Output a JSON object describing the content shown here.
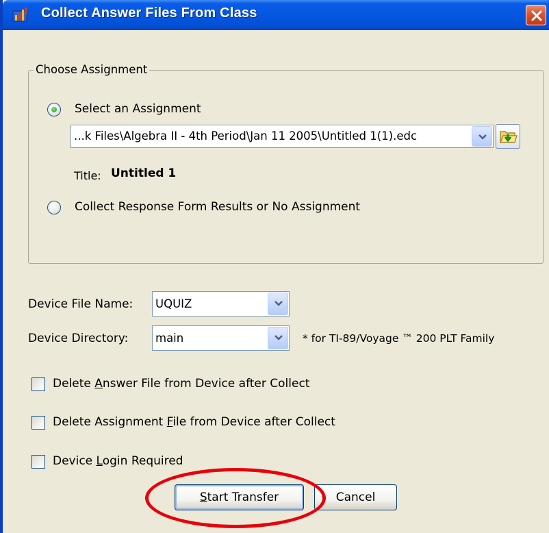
{
  "window": {
    "title": "Collect Answer Files From Class"
  },
  "group": {
    "legend": "Choose Assignment"
  },
  "assignment": {
    "select_label": "Select an Assignment",
    "select_checked": true,
    "path_value": "...k Files\\Algebra II - 4th Period\\Jan 11 2005\\Untitled 1(1).edc",
    "title_label": "Title:",
    "title_value": "Untitled 1",
    "collect_label": "Collect Response Form Results or No Assignment",
    "collect_checked": false
  },
  "device": {
    "file_name_label": "Device File Name:",
    "file_name_value": "UQUIZ",
    "directory_label": "Device Directory:",
    "directory_value": "main",
    "directory_note": "* for TI-89/Voyage ™ 200 PLT Family"
  },
  "options": {
    "delete_answer_pre": "Delete ",
    "delete_answer_key": "A",
    "delete_answer_post": "nswer File from Device after Collect",
    "delete_assignment_pre": "Delete Assignment ",
    "delete_assignment_key": "F",
    "delete_assignment_post": "ile from Device after Collect",
    "login_pre": "Device ",
    "login_key": "L",
    "login_post": "ogin Required"
  },
  "buttons": {
    "start_key": "S",
    "start_rest": "tart Transfer",
    "cancel": "Cancel"
  },
  "colors": {
    "title_bar": "#0557e0",
    "highlight": "#e8000b",
    "window_bg": "#ece9d8"
  },
  "icons": [
    "app-icon",
    "close-icon",
    "chevron-down-icon",
    "folder-open-icon"
  ]
}
